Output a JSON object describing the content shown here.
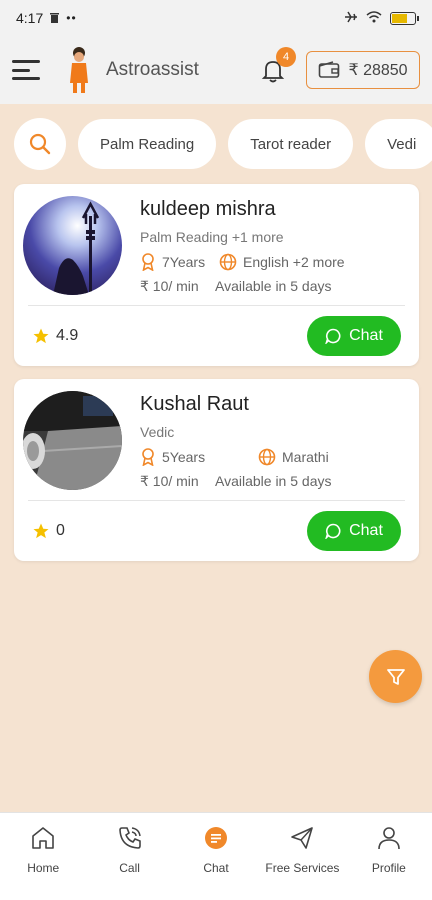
{
  "status_bar": {
    "time": "4:17"
  },
  "header": {
    "app_title": "Astroassist",
    "notification_count": "4",
    "wallet_balance": "₹ 28850"
  },
  "filters": {
    "chips": [
      "Palm Reading",
      "Tarot reader",
      "Vedi"
    ]
  },
  "astrologers": [
    {
      "name": "kuldeep mishra",
      "skills": "Palm Reading +1 more",
      "experience": "7Years",
      "languages": "English +2 more",
      "price": "₹ 10/ min",
      "availability": "Available in 5 days",
      "rating": "4.9",
      "chat_label": "Chat"
    },
    {
      "name": "Kushal Raut",
      "skills": "Vedic",
      "experience": "5Years",
      "languages": "Marathi",
      "price": "₹ 10/ min",
      "availability": "Available in 5 days",
      "rating": "0",
      "chat_label": "Chat"
    }
  ],
  "bottom_nav": {
    "items": [
      {
        "label": "Home",
        "icon": "home-icon"
      },
      {
        "label": "Call",
        "icon": "phone-icon"
      },
      {
        "label": "Chat",
        "icon": "chat-icon"
      },
      {
        "label": "Free Services",
        "icon": "send-icon"
      },
      {
        "label": "Profile",
        "icon": "user-icon"
      }
    ],
    "active": "Chat"
  },
  "colors": {
    "accent": "#f0882a",
    "chat_green": "#22bb22",
    "background": "#f5e3d1"
  }
}
